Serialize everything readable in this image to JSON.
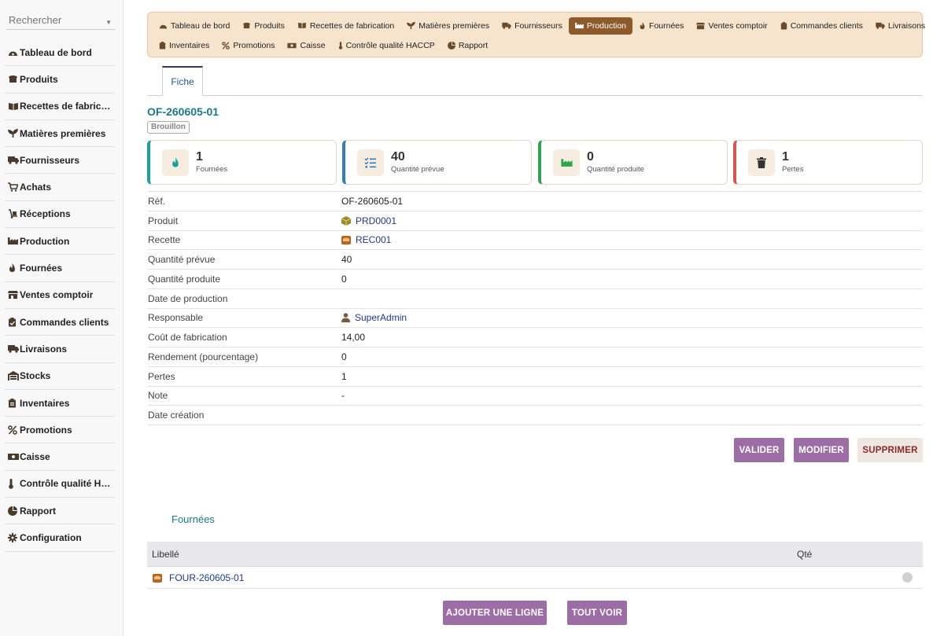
{
  "search": {
    "placeholder": "Rechercher"
  },
  "sidebar": {
    "items": [
      {
        "label": "Tableau de bord",
        "icon": "gauge-icon"
      },
      {
        "label": "Produits",
        "icon": "bread-icon"
      },
      {
        "label": "Recettes de fabrication",
        "icon": "book-icon"
      },
      {
        "label": "Matières premières",
        "icon": "seedling-icon"
      },
      {
        "label": "Fournisseurs",
        "icon": "truck-icon"
      },
      {
        "label": "Achats",
        "icon": "cart-icon"
      },
      {
        "label": "Réceptions",
        "icon": "dolly-icon"
      },
      {
        "label": "Production",
        "icon": "industry-icon"
      },
      {
        "label": "Fournées",
        "icon": "fire-icon"
      },
      {
        "label": "Ventes comptoir",
        "icon": "store-icon"
      },
      {
        "label": "Commandes clients",
        "icon": "clipboard-icon"
      },
      {
        "label": "Livraisons",
        "icon": "delivery-truck-icon"
      },
      {
        "label": "Stocks",
        "icon": "warehouse-icon"
      },
      {
        "label": "Inventaires",
        "icon": "clipboard-list-icon"
      },
      {
        "label": "Promotions",
        "icon": "percent-icon"
      },
      {
        "label": "Caisse",
        "icon": "money-icon"
      },
      {
        "label": "Contrôle qualité HA…",
        "icon": "thermometer-icon"
      },
      {
        "label": "Rapport",
        "icon": "pie-chart-icon"
      },
      {
        "label": "Configuration",
        "icon": "cog-icon"
      }
    ]
  },
  "topmenu": {
    "row1": [
      {
        "label": "Tableau de bord",
        "icon": "gauge-icon"
      },
      {
        "label": "Produits",
        "icon": "bread-icon"
      },
      {
        "label": "Recettes de fabrication",
        "icon": "book-icon"
      },
      {
        "label": "Matières premières",
        "icon": "seedling-icon"
      },
      {
        "label": "Fournisseurs",
        "icon": "truck-icon"
      },
      {
        "label": "Production",
        "icon": "industry-icon",
        "active": true
      },
      {
        "label": "Fournées",
        "icon": "fire-icon"
      },
      {
        "label": "Ventes comptoir",
        "icon": "store-icon"
      },
      {
        "label": "Commandes clients",
        "icon": "clipboard-icon"
      },
      {
        "label": "Livraisons",
        "icon": "delivery-truck-icon"
      }
    ],
    "row2": [
      {
        "label": "Inventaires",
        "icon": "clipboard-list-icon"
      },
      {
        "label": "Promotions",
        "icon": "percent-icon"
      },
      {
        "label": "Caisse",
        "icon": "money-icon"
      },
      {
        "label": "Contrôle qualité HACCP",
        "icon": "thermometer-icon"
      },
      {
        "label": "Rapport",
        "icon": "pie-chart-icon"
      }
    ]
  },
  "tabs": [
    {
      "label": "Fiche"
    }
  ],
  "record": {
    "ref": "OF-260605-01",
    "status": "Brouillon"
  },
  "stats": [
    {
      "value": "1",
      "label": "Fournées",
      "icon": "fire-icon",
      "color": "#1aa39a"
    },
    {
      "value": "40",
      "label": "Quantité prévue",
      "icon": "list-check-icon",
      "color": "#2f7ec4"
    },
    {
      "value": "0",
      "label": "Quantité produite",
      "icon": "industry-icon",
      "color": "#2ea44f"
    },
    {
      "value": "1",
      "label": "Pertes",
      "icon": "trash-icon",
      "color": "#d9534f"
    }
  ],
  "fields": [
    {
      "label": "Réf.",
      "value": "OF-260605-01"
    },
    {
      "label": "Produit",
      "value": "PRD0001",
      "icon": "box-icon"
    },
    {
      "label": "Recette",
      "value": "REC001",
      "icon": "recipe-icon"
    },
    {
      "label": "Quantité prévue",
      "value": "40"
    },
    {
      "label": "Quantité produite",
      "value": "0"
    },
    {
      "label": "Date de production",
      "value": ""
    },
    {
      "label": "Responsable",
      "value": "SuperAdmin",
      "icon": "user-icon"
    },
    {
      "label": "Coût de fabrication",
      "value": "14,00"
    },
    {
      "label": "Rendement (pourcentage)",
      "value": "0"
    },
    {
      "label": "Pertes",
      "value": "1"
    },
    {
      "label": "Note",
      "value": "-"
    },
    {
      "label": "Date création",
      "value": ""
    }
  ],
  "actions": {
    "validate": "VALIDER",
    "modify": "MODIFIER",
    "delete": "SUPPRIMER"
  },
  "batches": {
    "title": "Fournées",
    "columns": [
      "Libellé",
      "Qté"
    ],
    "rows": [
      {
        "label": "FOUR-260605-01",
        "qty": ""
      }
    ],
    "add_label": "AJOUTER UNE LIGNE",
    "view_all_label": "TOUT VOIR"
  },
  "colors": {
    "accent": "#8c5a2b",
    "menu_bg": "#f6e4cd",
    "button": "#9d6da6",
    "link": "#1f3a8a",
    "title": "#1a7a8a"
  }
}
